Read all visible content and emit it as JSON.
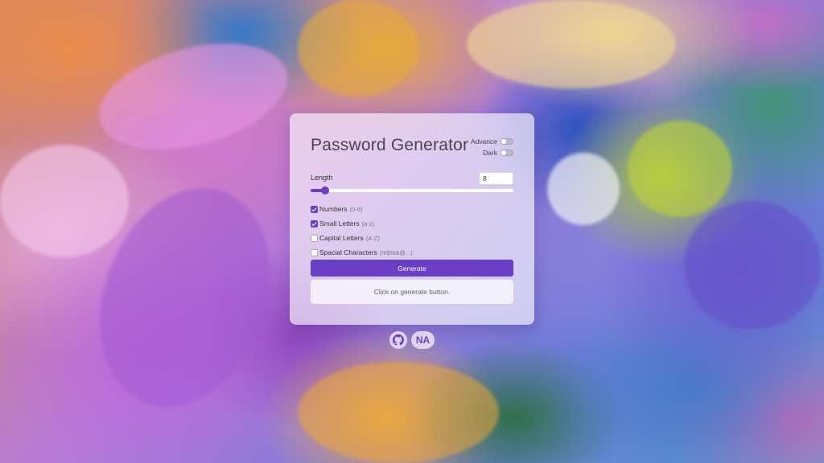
{
  "app": {
    "title": "Password Generator"
  },
  "toggles": {
    "advance_label": "Advance",
    "advance_on": false,
    "dark_label": "Dark",
    "dark_on": false
  },
  "length": {
    "label": "Length",
    "value": "8",
    "slider_fraction": 0.07
  },
  "options": [
    {
      "label": "Numbers",
      "hint": "(0-9)",
      "checked": true
    },
    {
      "label": "Small Letters",
      "hint": "(a-z)",
      "checked": true
    },
    {
      "label": "Capital Letters",
      "hint": "(A-Z)",
      "checked": false
    },
    {
      "label": "Spacial Characters",
      "hint": "(!#$%&@...)",
      "checked": false
    }
  ],
  "generate": {
    "label": "Generate"
  },
  "output": {
    "text": "Click on generate button."
  },
  "footer": {
    "github_icon": "github-icon",
    "avatar_initials": "NA"
  },
  "colors": {
    "accent": "#6a3fc6"
  }
}
